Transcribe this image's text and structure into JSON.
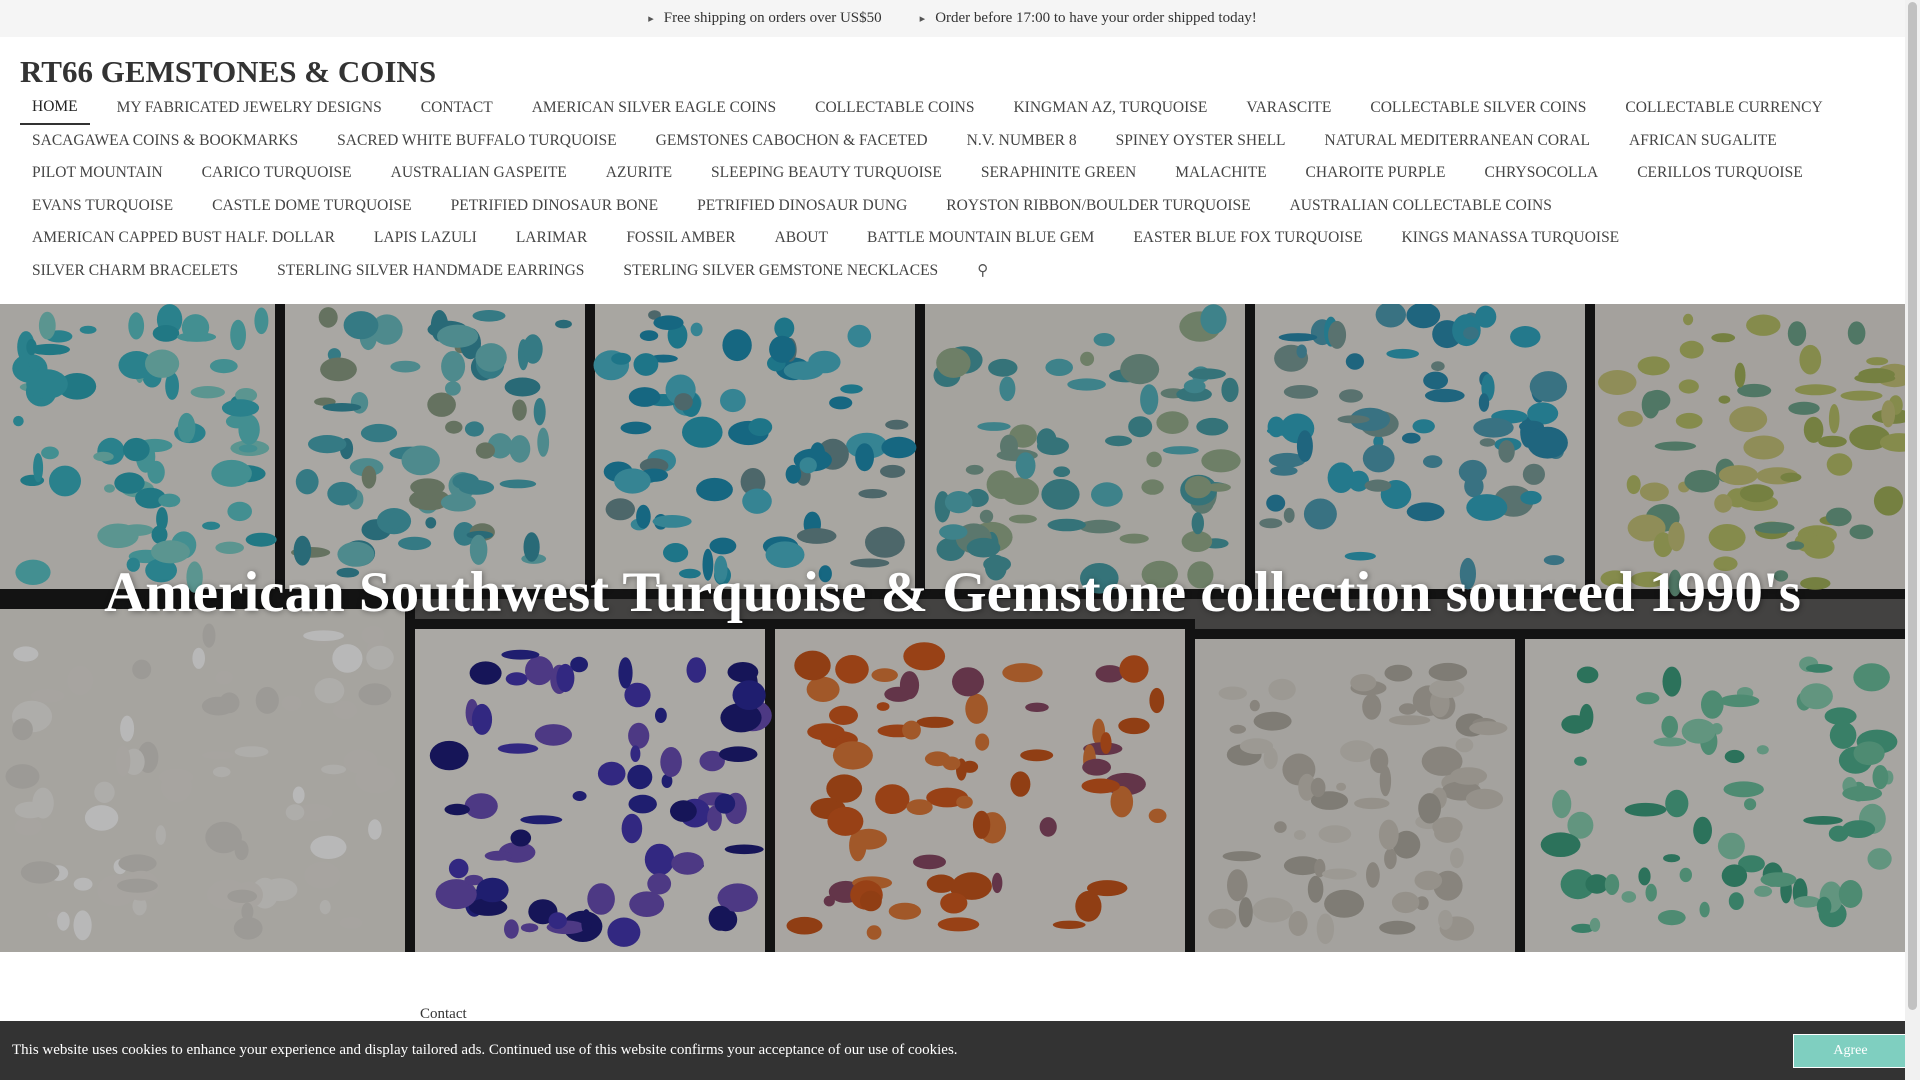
{
  "topbar": {
    "shipping": "Free shipping on orders over US$50",
    "order_deadline": "Order before 17:00 to have your order shipped today!"
  },
  "header": {
    "site_title": "RT66 GEMSTONES & COINS"
  },
  "nav": {
    "items": [
      "HOME",
      "MY FABRICATED JEWELRY DESIGNS",
      "CONTACT",
      "AMERICAN SILVER EAGLE COINS",
      "COLLECTABLE COINS",
      "KINGMAN AZ, TURQUOISE",
      "VARASCITE",
      "COLLECTABLE SILVER COINS",
      "COLLECTABLE CURRENCY",
      "SACAGAWEA COINS & BOOKMARKS",
      "SACRED WHITE BUFFALO TURQUOISE",
      "GEMSTONES CABOCHON & FACETED",
      "N.V. NUMBER 8",
      "SPINEY OYSTER SHELL",
      "NATURAL MEDITERRANEAN CORAL",
      "AFRICAN SUGALITE",
      "PILOT MOUNTAIN",
      "CARICO TURQUOISE",
      "AUSTRALIAN GASPEITE",
      "AZURITE",
      "SLEEPING BEAUTY TURQUOISE",
      "SERAPHINITE GREEN",
      "MALACHITE",
      "CHAROITE PURPLE",
      "CHRYSOCOLLA",
      "CERILLOS TURQUOISE",
      "EVANS TURQUOISE",
      "CASTLE DOME TURQUOISE",
      "PETRIFIED DINOSAUR BONE",
      "PETRIFIED DINOSAUR DUNG",
      "ROYSTON RIBBON/BOULDER TURQUOISE",
      "AUSTRALIAN COLLECTABLE COINS",
      "AMERICAN CAPPED BUST HALF. DOLLAR",
      "LAPIS LAZULI",
      "LARIMAR",
      "FOSSIL AMBER",
      "ABOUT",
      "BATTLE MOUNTAIN BLUE GEM",
      "EASTER BLUE FOX TURQUOISE",
      "KINGS MANASSA TURQUOISE",
      "SILVER CHARM BRACELETS",
      "STERLING SILVER HANDMADE EARRINGS",
      "STERLING SILVER GEMSTONE NECKLACES"
    ],
    "active_index": 0,
    "search_icon": "search-icon"
  },
  "hero": {
    "title": "American Southwest Turquoise & Gemstone collection sourced 1990's"
  },
  "content": {
    "section_label": "Contact"
  },
  "cookie": {
    "message": "This website uses cookies to enhance your experience and display tailored ads. Continued use of this website confirms your acceptance of our use of cookies.",
    "agree_label": "Agree"
  },
  "colors": {
    "accent": "#7fcfc0",
    "cookie_bg": "#333333",
    "topbar_bg": "#f5f5f5"
  }
}
